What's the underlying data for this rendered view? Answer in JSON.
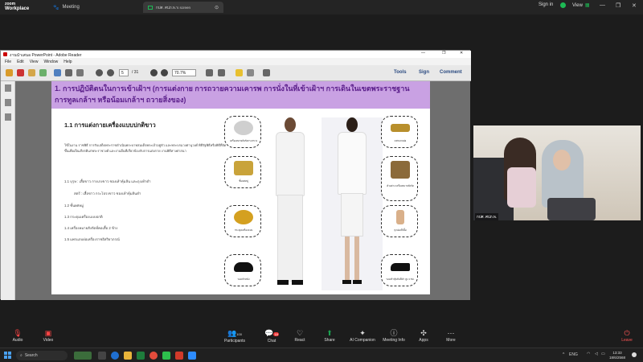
{
  "zoom": {
    "brand_line1": "zoom",
    "brand_line2": "Workplace",
    "tab_home": "Home",
    "tab_meeting": "Meeting",
    "tab_screen": "กปศ. ศปภ.พ.'s screen",
    "sign_in": "Sign in",
    "view": "View"
  },
  "reader": {
    "title": "งานนำเสนอ PowerPoint - Adobe Reader",
    "menu": [
      "File",
      "Edit",
      "View",
      "Window",
      "Help"
    ],
    "page_current": "5",
    "page_total": "/ 31",
    "zoom_level": "70.7%",
    "links": [
      "Tools",
      "Sign",
      "Comment"
    ]
  },
  "slide": {
    "title_line1": "1. การปฏิบัติตนในการเข้าเฝ้าฯ (การแต่งกาย การถวายความเคารพ การนั่งในที่เข้าเฝ้าฯ การเดินในเขตพระราชฐาน",
    "title_line2": "การทูลเกล้าฯ หรือน้อมเกล้าฯ ถวายสิ่งของ)",
    "subtitle": "1.1 การแต่งกายเครื่องแบบปกติขาว",
    "paragraph": "ใช้ในงาน ราชพิธี การรับเสด็จพระราชดำเนินพระบาทสมเด็จพระเจ้าอยู่หัว และพระบรมวงศานุวงศ์ พิธีรัฐพิธีหรือพิธีที่จัดขึ้นเพื่อเป็นเกียรติแก่พระราชวงศ์ และงานอื่นที่เกี่ยวข้องกับการแต่งกาย งานพิธีทางศาสนา",
    "items": [
      "1.1 บุรุษ : เสื้อขาว กางเกงขาว ซองเท้าหุ้มส้น และถุงเท้าดำ",
      "สตรี : เสื้อขาว กระโปรงขาว ซองเท้าหุ้มส้นดำ",
      "1.2 ชั้นยศหมู่",
      "1.3 กระดุมเครื่องแบบปกติ",
      "1.4 เครื่องหมายสังกัดที่คอเสื้อ 2 ข้าง",
      "1.5 แพรแถบย่อเครื่องราชอิสริยาภรณ์"
    ],
    "badges_left": [
      "เครื่องหมายสังกัดกระทรวง",
      "ชั้นยศหมู่",
      "กระดุมเครื่องแบบ",
      "รองเท้าหนัง"
    ],
    "badges_right": [
      "แพรแถบย่อ",
      "ตัวอย่าง เครื่องหมายสังกัด",
      "ถุงน่องสีเนื้อ",
      "รองเท้าหุ้มส้นสีดำ สูง 3 ซม."
    ]
  },
  "video": {
    "name_tag": "กปศ. ศปภ.พ."
  },
  "controls": {
    "audio": "Audio",
    "video": "Video",
    "participants": "Participants",
    "participants_count": "100",
    "chat": "Chat",
    "chat_badge": "18",
    "react": "React",
    "share": "Share",
    "ai": "AI Companion",
    "info": "Meeting Info",
    "apps": "Apps",
    "more": "More",
    "leave": "Leave"
  },
  "taskbar": {
    "search": "Search",
    "lang": "ENG",
    "time": "13:33",
    "date": "18/6/2568"
  },
  "colors": {
    "slide_header": "#c9a1e3",
    "slide_title": "#5a1e8a",
    "zoom_green": "#1db954",
    "share_green": "#1aa050"
  }
}
